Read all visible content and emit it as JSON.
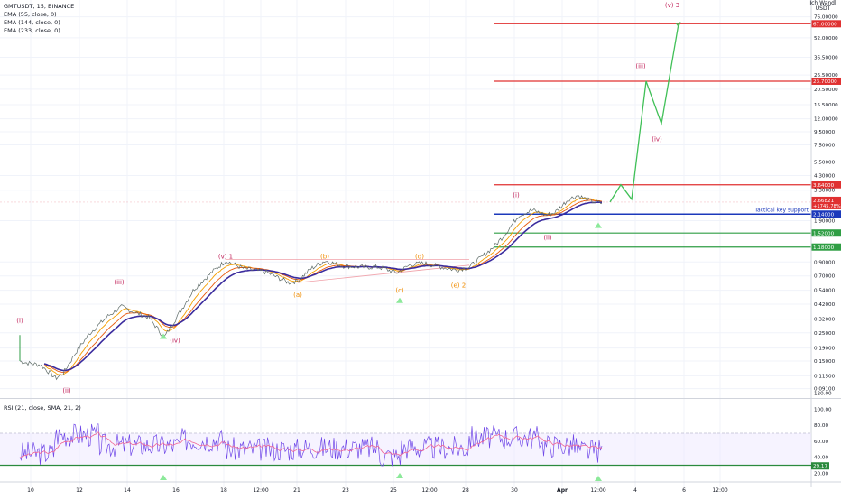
{
  "header": {
    "symbol_line": "GMTUSDT, 15, BINANCE",
    "indicators": [
      "EMA (55, close, 0)",
      "EMA (144, close, 0)",
      "EMA (233, close, 0)"
    ]
  },
  "axis_header": {
    "line1": "Ich Wandl",
    "line2": "USDT"
  },
  "rsi_header": "RSI (21, close, SMA, 21, 2)",
  "chart_data": [
    {
      "type": "line",
      "scale": "log",
      "y_ticks": [
        76.0,
        52.0,
        36.5,
        26.5,
        20.5,
        15.5,
        12.0,
        9.5,
        7.5,
        5.5,
        4.3,
        3.3,
        1.9,
        0.9,
        0.7,
        0.54,
        0.42,
        0.32,
        0.25,
        0.19,
        0.15,
        0.115,
        0.091
      ],
      "y_tick_labels": [
        "76.00000",
        "52.00000",
        "36.50000",
        "26.50000",
        "20.50000",
        "15.50000",
        "12.00000",
        "9.50000",
        "7.50000",
        "5.50000",
        "4.30000",
        "3.30000",
        "1.90000",
        "0.90000",
        "0.70000",
        "0.54000",
        "0.42000",
        "0.32000",
        "0.25000",
        "0.19000",
        "0.15000",
        "0.11500",
        "0.09100"
      ],
      "x_tick_labels": [
        "10",
        "12",
        "14",
        "16",
        "18",
        "12:00",
        "21",
        "23",
        "25",
        "12:00",
        "28",
        "30",
        "Apr",
        "12:00",
        "4",
        "6",
        "12:00"
      ],
      "horizontal_levels": [
        {
          "value": 67.0,
          "label": "67.00000",
          "color": "#e03131"
        },
        {
          "value": 23.7,
          "label": "23.70000",
          "color": "#e03131"
        },
        {
          "value": 3.64,
          "label": "3.64000",
          "color": "#e03131"
        },
        {
          "value": 2.14,
          "label": "2.14000",
          "color": "#1c39bb",
          "note": "Tactical key support"
        },
        {
          "value": 1.52,
          "label": "1.52000",
          "color": "#2f9e44"
        },
        {
          "value": 1.18,
          "label": "1.18000",
          "color": "#2f9e44"
        }
      ],
      "current_price": {
        "value": 2.66,
        "label": "2.66821",
        "change": "+1745.78%"
      },
      "projection": [
        {
          "value": 2.66
        },
        {
          "value": 3.64
        },
        {
          "value": 2.8
        },
        {
          "value": 23.7
        },
        {
          "value": 11.0
        },
        {
          "value": 67.0
        }
      ],
      "wave_labels": [
        {
          "text": "(i)",
          "value": 0.3,
          "color": "#c2255c"
        },
        {
          "text": "(ii)",
          "value": 0.085,
          "color": "#c2255c"
        },
        {
          "text": "(iii)",
          "value": 0.6,
          "color": "#c2255c"
        },
        {
          "text": "(iv)",
          "value": 0.21,
          "color": "#c2255c"
        },
        {
          "text": "(v) 1",
          "value": 0.96,
          "color": "#c2255c"
        },
        {
          "text": "(a)",
          "value": 0.48,
          "color": "#f08c00"
        },
        {
          "text": "(b)",
          "value": 0.96,
          "color": "#f08c00"
        },
        {
          "text": "(c)",
          "value": 0.52,
          "color": "#f08c00"
        },
        {
          "text": "(d)",
          "value": 0.96,
          "color": "#f08c00"
        },
        {
          "text": "(e) 2",
          "value": 0.57,
          "color": "#f08c00"
        },
        {
          "text": "(i)",
          "value": 2.9,
          "color": "#c2255c"
        },
        {
          "text": "(ii)",
          "value": 1.35,
          "color": "#c2255c"
        },
        {
          "text": "(iii)",
          "value": 30.0,
          "color": "#c2255c"
        },
        {
          "text": "(iv)",
          "value": 8.0,
          "color": "#c2255c"
        },
        {
          "text": "(v) 3",
          "value": 90.0,
          "color": "#c2255c"
        }
      ],
      "series": [
        {
          "name": "price",
          "color": "#2f9e44"
        },
        {
          "name": "EMA 55",
          "color": "#f59f00"
        },
        {
          "name": "EMA 144",
          "color": "#e8590c"
        },
        {
          "name": "EMA 233",
          "color": "#3b2c9e"
        }
      ]
    },
    {
      "type": "line",
      "y_ticks": [
        120,
        100,
        80,
        60,
        40,
        20
      ],
      "y_tick_labels": [
        "120.00",
        "100.00",
        "80.00",
        "60.00",
        "40.00",
        "20.00"
      ],
      "levels": [
        70,
        50,
        30
      ],
      "current_value": {
        "value": 29.17,
        "label": "29.17"
      },
      "series": [
        {
          "name": "RSI",
          "color": "#7048e8"
        },
        {
          "name": "RSI MA",
          "color": "#f06595"
        }
      ]
    }
  ]
}
